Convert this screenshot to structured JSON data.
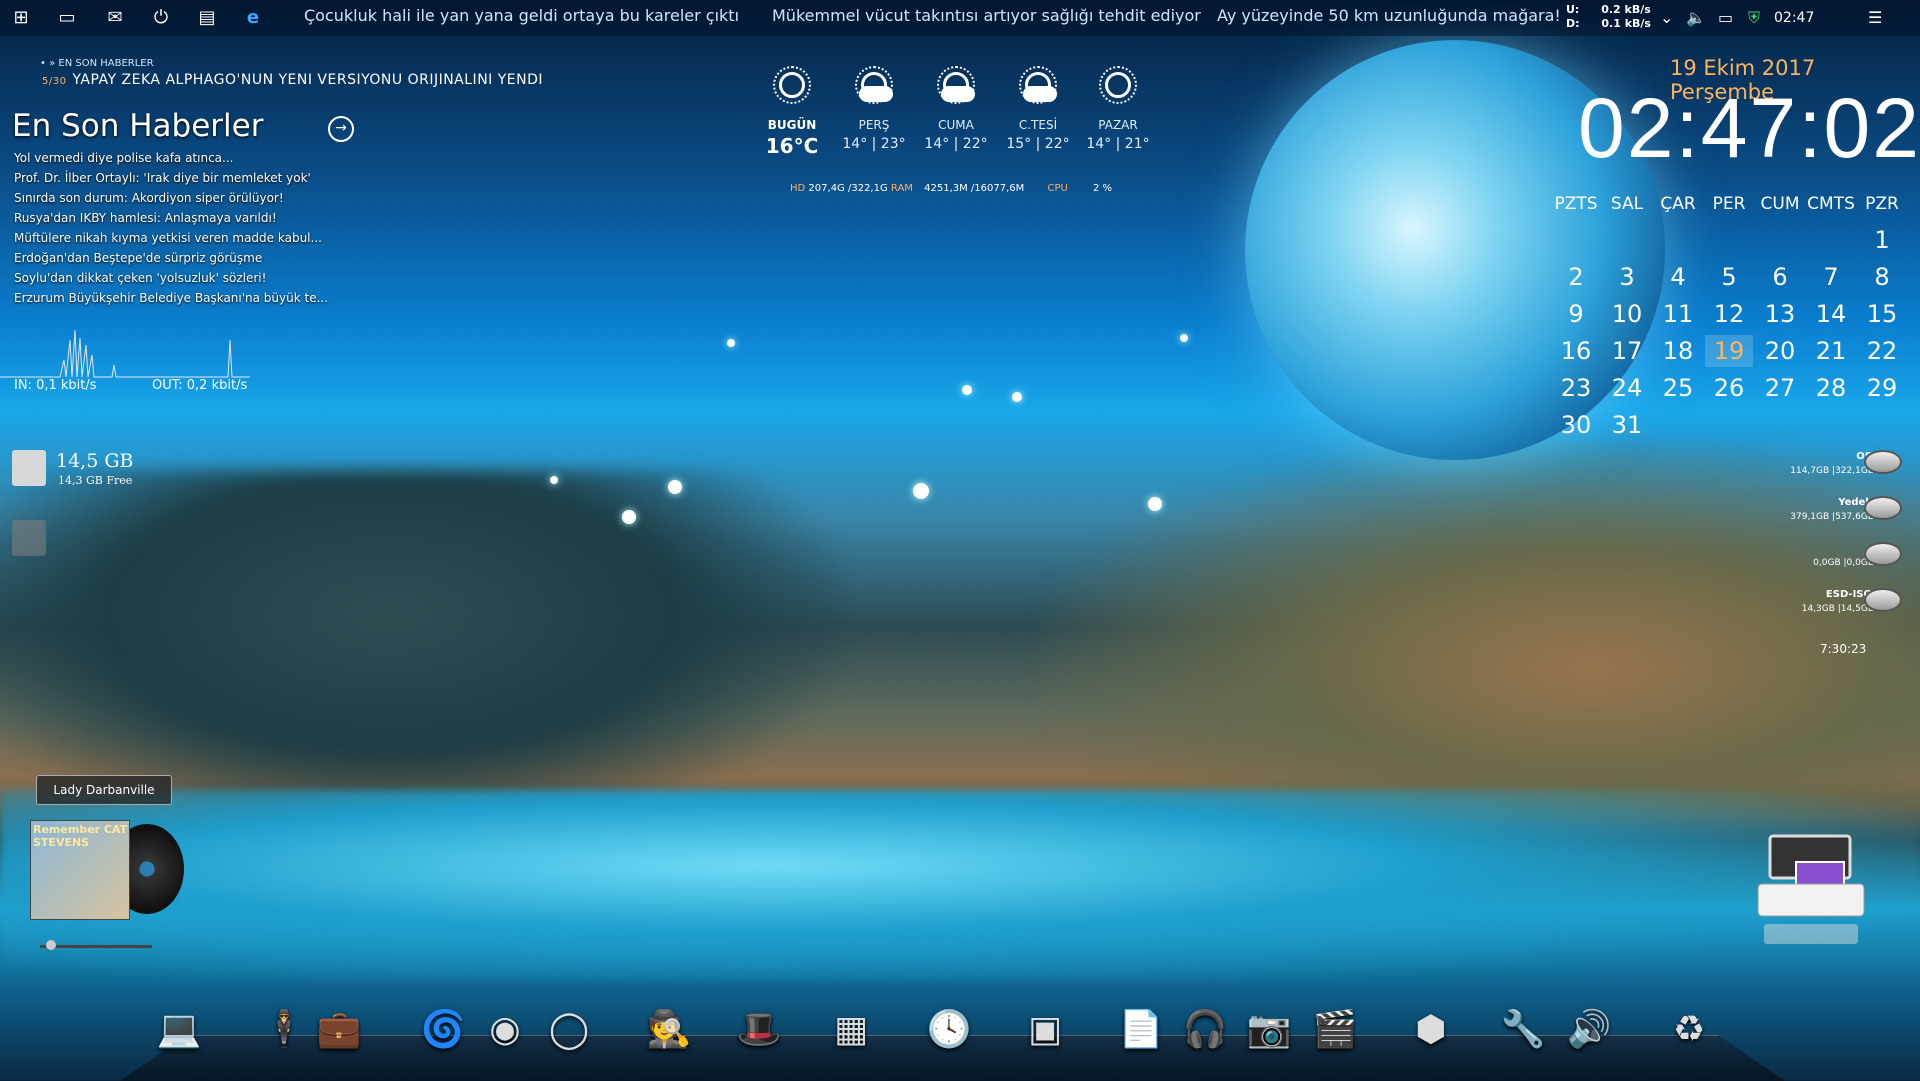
{
  "taskbar": {
    "tickers": [
      "Çocukluk hali ile yan yana geldi ortaya bu kareler çıktı",
      "Mükemmel vücut takıntısı artıyor sağlığı tehdit ediyor",
      "Ay yüzeyinde 50 km uzunluğunda mağara!"
    ],
    "upload_label": "U:",
    "download_label": "D:",
    "upload_speed": "0.2 kB/s",
    "download_speed": "0.1 kB/s",
    "clock": "02:47",
    "icons": [
      "windows-start-icon",
      "task-view-icon",
      "mail-icon",
      "power-icon",
      "file-explorer-icon",
      "edge-icon"
    ]
  },
  "news": {
    "section": "• » EN SON HABERLER",
    "counter": "5/30",
    "headline": "YAPAY ZEKA ALPHAGO'NUN YENI VERSIYONU ORIJINALINI YENDI",
    "title": "En Son Haberler",
    "items": [
      "Yol vermedi diye polise kafa atınca...",
      "Prof. Dr. İlber Ortaylı: 'Irak diye bir memleket yok'",
      "Sınırda son durum: Akordiyon siper örülüyor!",
      "Rusya'dan IKBY hamlesi: Anlaşmaya varıldı!",
      "Müftülere nikah kıyma yetkisi veren madde kabul...",
      "Erdoğan'dan Beştepe'de sürpriz görüşme",
      "Soylu'dan dikkat çeken 'yolsuzluk' sözleri!",
      "Erzurum Büyükşehir Belediye Başkanı'na büyük te..."
    ]
  },
  "network": {
    "in": "IN: 0,1 kbit/s",
    "out": "OUT: 0,2 kbit/s"
  },
  "usb": {
    "size": "14,5 GB",
    "free": "14,3 GB Free"
  },
  "weather": {
    "days": [
      {
        "name": "BUGÜN",
        "temp": "16°C",
        "icon": "sun-icon",
        "today": true
      },
      {
        "name": "PERŞ",
        "temp": "14° | 23°",
        "icon": "partly-cloudy-icon"
      },
      {
        "name": "CUMA",
        "temp": "14° | 22°",
        "icon": "partly-cloudy-icon"
      },
      {
        "name": "C.TESİ",
        "temp": "15° | 22°",
        "icon": "partly-cloudy-icon"
      },
      {
        "name": "PAZAR",
        "temp": "14° | 21°",
        "icon": "sun-icon"
      }
    ]
  },
  "system": {
    "hd_label": "HD",
    "hd_value": "207,4G /322,1G",
    "ram_label": "RAM",
    "ram_value": "4251,3M /16077,6M",
    "cpu_label": "CPU",
    "cpu_value": "2 %"
  },
  "clock": {
    "date": "19 Ekim 2017 Perşembe",
    "time": "02:47:02"
  },
  "calendar": {
    "headers": [
      "PZTS",
      "SAL",
      "ÇAR",
      "PER",
      "CUM",
      "CMTS",
      "PZR"
    ],
    "today": 19,
    "first_weekday_index": 6,
    "days_in_month": 31
  },
  "drives": [
    {
      "name": "OS",
      "info": "114,7GB |322,1GB"
    },
    {
      "name": "Yedek",
      "info": "379,1GB |537,6GB"
    },
    {
      "name": "",
      "info": "0,0GB |0,0GB"
    },
    {
      "name": "ESD-ISO",
      "info": "14,3GB |14,5GB"
    }
  ],
  "uptime": "7:30:23",
  "music": {
    "song": "Lady Darbanville",
    "album_text": "Remember CAT STEVENS",
    "progress": 0.05
  },
  "dock": {
    "icons": [
      "laptop-icon",
      "agent-icon",
      "briefcase-icon",
      "swirl-icon",
      "orb-icon",
      "ring-icon",
      "spy-icon",
      "hat-icon",
      "chip-icon",
      "clock-icon",
      "asus-icon",
      "notes-icon",
      "headphones-icon",
      "camera-icon",
      "clapper-icon",
      "sphere-icon",
      "tool-icon",
      "speaker-icon",
      "recycle-bin-icon"
    ],
    "glyphs": [
      "💻",
      "🕴",
      "💼",
      "🌀",
      "◉",
      "◯",
      "🕵",
      "🎩",
      "▦",
      "🕓",
      "▣",
      "📄",
      "🎧",
      "📷",
      "🎬",
      "⬢",
      "🔧",
      "🔊",
      "♻"
    ]
  }
}
